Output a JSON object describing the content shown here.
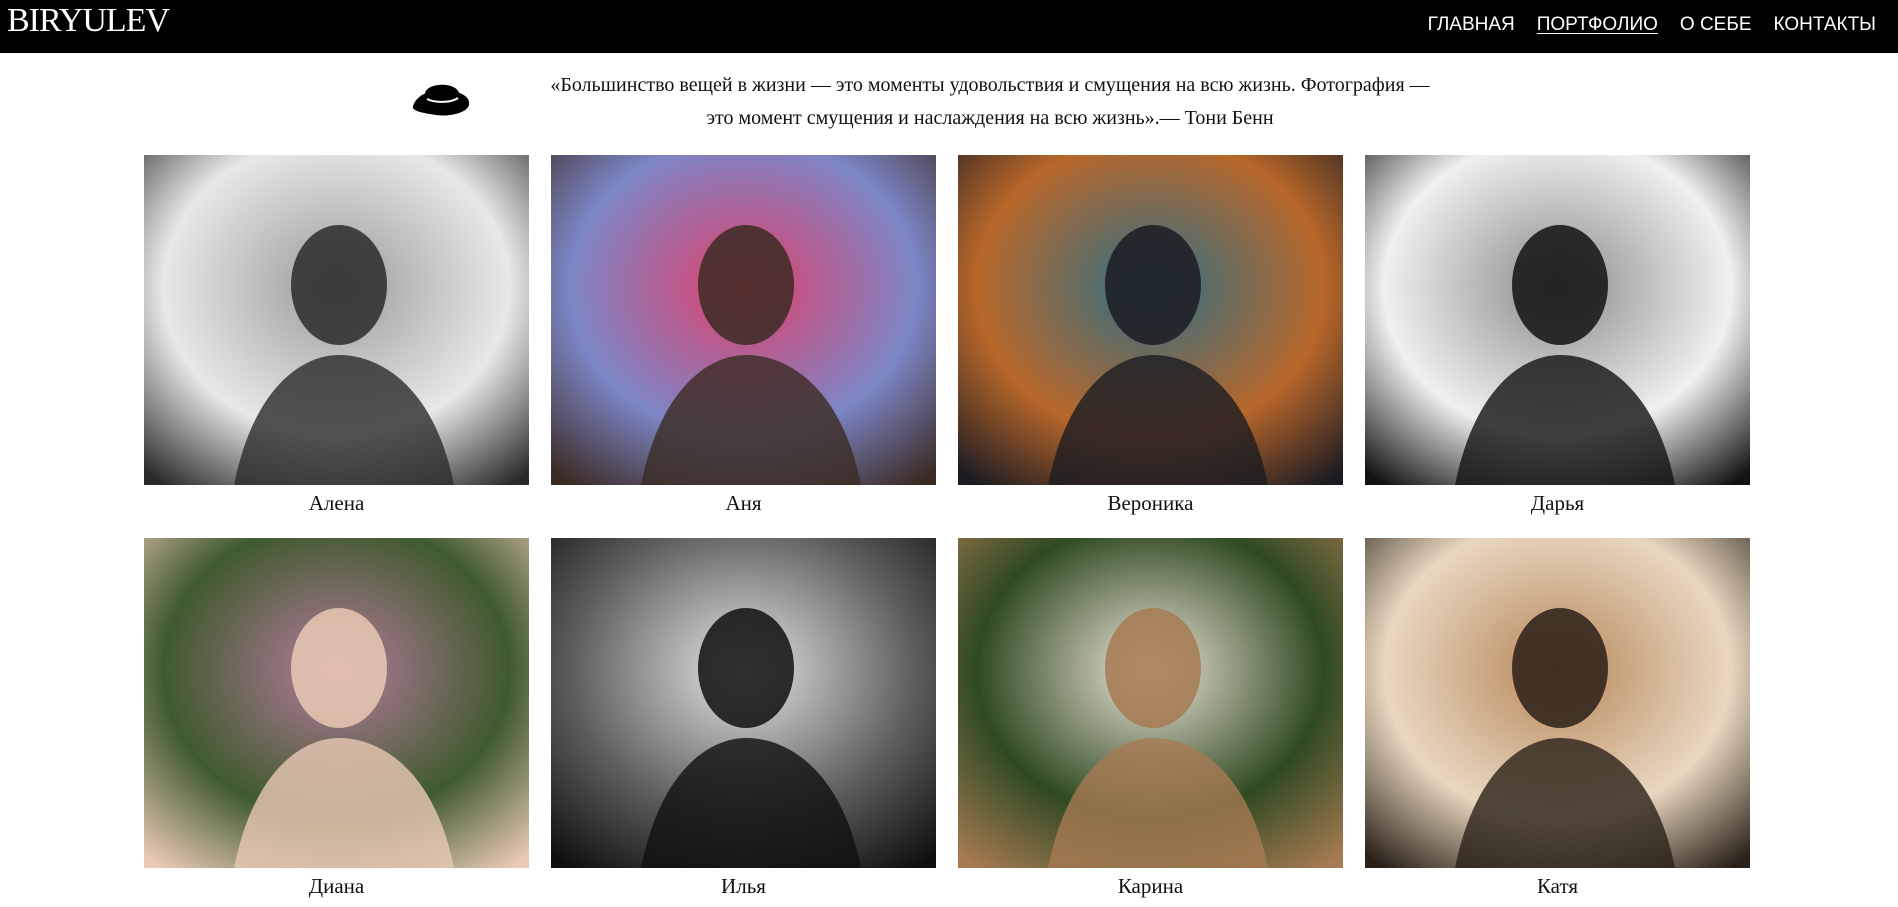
{
  "header": {
    "logo": "BIRYULEV",
    "nav": [
      {
        "label": "ГЛАВНАЯ",
        "active": false
      },
      {
        "label": "ПОРТФОЛИО",
        "active": true
      },
      {
        "label": "О СЕБЕ",
        "active": false
      },
      {
        "label": "КОНТАКТЫ",
        "active": false
      }
    ]
  },
  "quote": {
    "line1": "«Большинство вещей в жизни — это моменты удовольствия и смущения на  всю жизнь. Фотография —",
    "line2": "это момент смущения и наслаждения на всю жизнь».— Тони Бенн",
    "icon": "hat-icon"
  },
  "portfolio": [
    {
      "name": "Алена",
      "tone": "bw",
      "colors": [
        "#e8e8e8",
        "#2a2a2a",
        "#9a9a9a"
      ]
    },
    {
      "name": "Аня",
      "tone": "color",
      "colors": [
        "#7c86c6",
        "#3b2a22",
        "#e0406a"
      ]
    },
    {
      "name": "Вероника",
      "tone": "color",
      "colors": [
        "#b8672a",
        "#1b1b22",
        "#2f6f86"
      ]
    },
    {
      "name": "Дарья",
      "tone": "bw",
      "colors": [
        "#f0f0f0",
        "#121212",
        "#8a8a8a"
      ]
    },
    {
      "name": "Диана",
      "tone": "color",
      "colors": [
        "#3f5a2e",
        "#e9c9b4",
        "#b57c9c"
      ]
    },
    {
      "name": "Илья",
      "tone": "bw",
      "colors": [
        "#5c5c5c",
        "#0f0f0f",
        "#e6e6e6"
      ]
    },
    {
      "name": "Карина",
      "tone": "color",
      "colors": [
        "#2f4a22",
        "#a67a52",
        "#efe6dc"
      ]
    },
    {
      "name": "Катя",
      "tone": "color",
      "colors": [
        "#e8d7c0",
        "#2a2018",
        "#b7875a"
      ]
    }
  ]
}
